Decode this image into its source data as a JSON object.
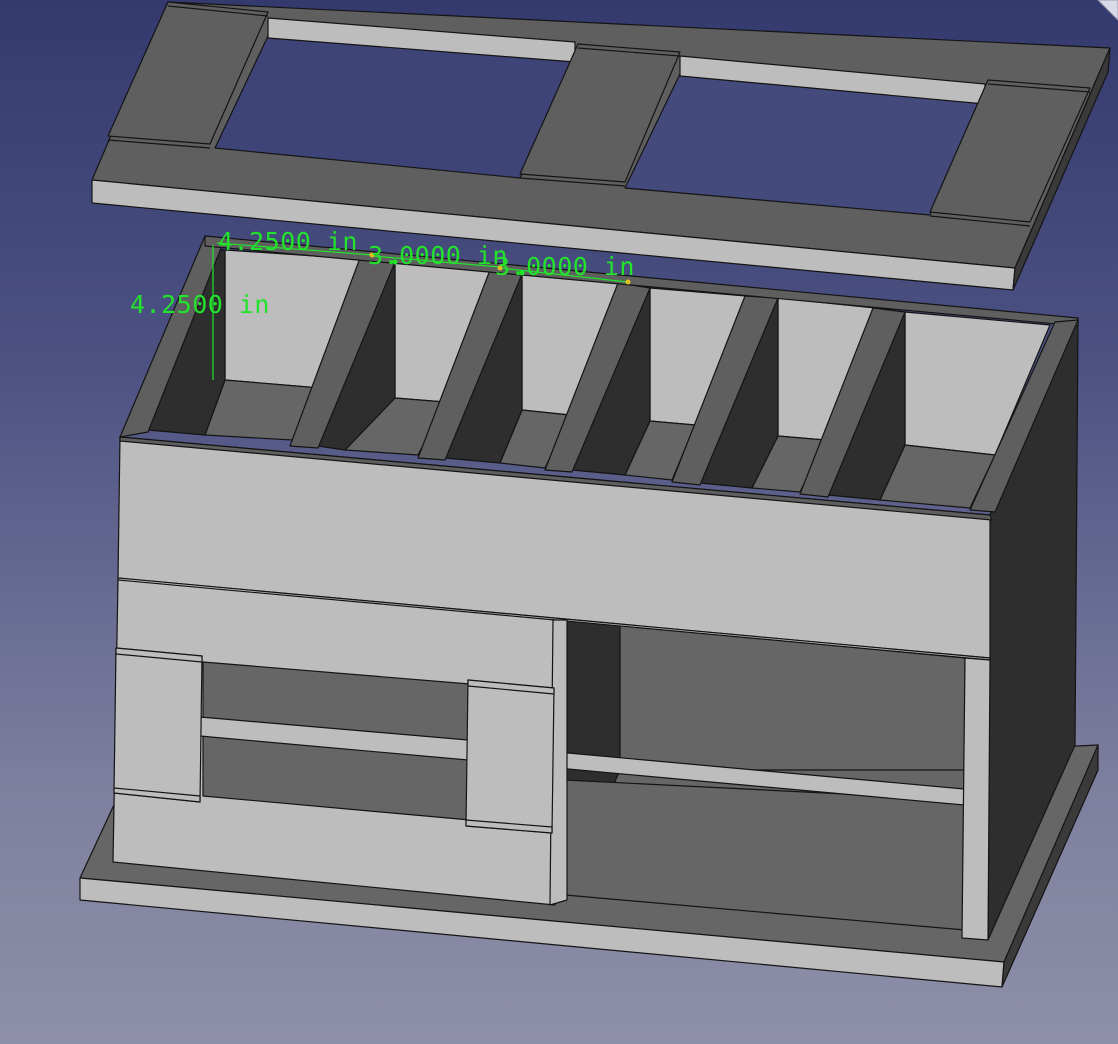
{
  "view": {
    "background_top": "#343a6e",
    "background_bottom": "#8e8fa8",
    "face_light": "#bdbdbd",
    "face_mid": "#666666",
    "face_dark": "#2e2e2e",
    "dimension_color": "#22e22c"
  },
  "dimensions": [
    {
      "id": "dim-width-1",
      "text": "4.2500 in"
    },
    {
      "id": "dim-width-2",
      "text": "3.0000 in"
    },
    {
      "id": "dim-width-3",
      "text": "3.0000 in"
    },
    {
      "id": "dim-height",
      "text": "4.2500 in"
    }
  ],
  "icons": {
    "navigation_cube": "navigation-cube-corner-icon"
  }
}
